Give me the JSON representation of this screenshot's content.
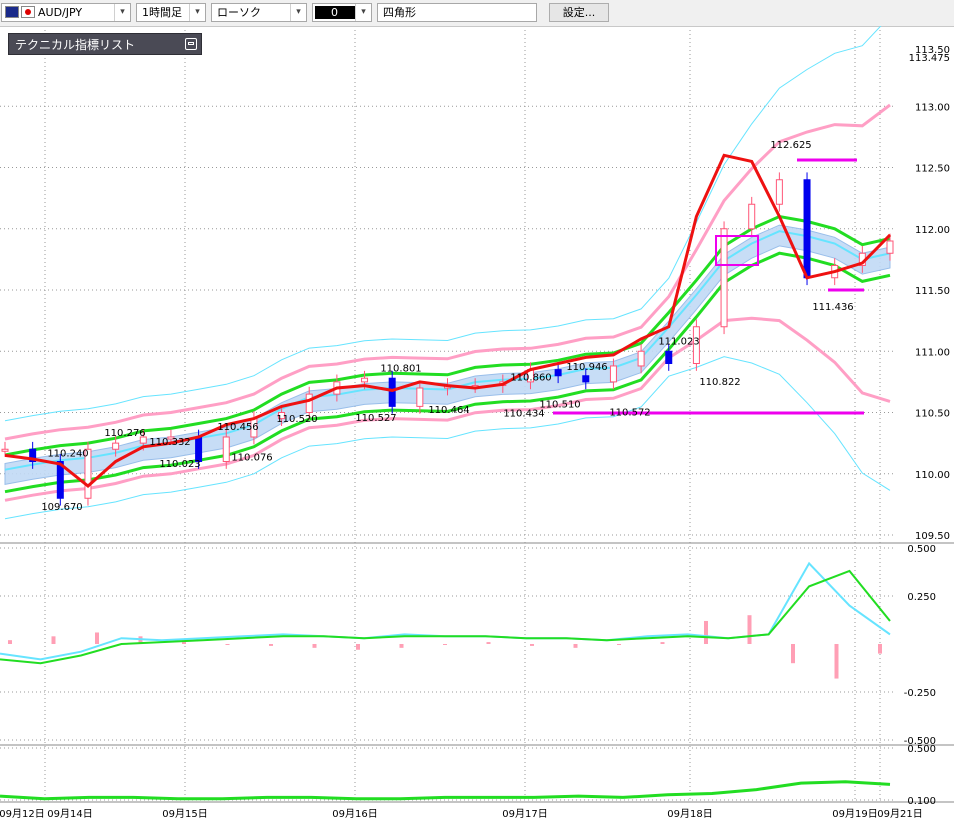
{
  "toolbar": {
    "symbol": "AUD/JPY",
    "timeframe": "1時間足",
    "chart_style": "ローソク",
    "color_swatch": "0",
    "shape": "四角形",
    "settings_label": "設定..."
  },
  "indicator_panel": {
    "title": "テクニカル指標リスト"
  },
  "colors": {
    "ma_red": "#ee1111",
    "bollinger_pink": "#ff9fc5",
    "bollinger_cyan": "#66e4ff",
    "envelope_green": "#22dd22",
    "marker_magenta": "#ee00ee",
    "up_candle": "#ff5577",
    "down_candle": "#0000ee",
    "cloud": "#c2daf6"
  },
  "chart_data": [
    {
      "type": "candlestick",
      "title": "",
      "y_axis_labels": [
        "113.00",
        "112.50",
        "112.00",
        "111.50",
        "111.00",
        "110.50",
        "110.00",
        "109.50"
      ],
      "y_axis_top_labels": [
        "113.50",
        "113.475"
      ],
      "ylim": [
        109.5,
        113.5
      ],
      "x_axis_labels": [
        "09月12日",
        "09月14日",
        "09月15日",
        "09月16日",
        "09月17日",
        "09月18日",
        "09月19日",
        "09月21日"
      ],
      "price_annotations": [
        {
          "label": "109.670",
          "value": 109.67
        },
        {
          "label": "110.240",
          "value": 110.24
        },
        {
          "label": "110.276",
          "value": 110.276
        },
        {
          "label": "110.332",
          "value": 110.332
        },
        {
          "label": "110.023",
          "value": 110.023
        },
        {
          "label": "110.456",
          "value": 110.456
        },
        {
          "label": "110.076",
          "value": 110.076
        },
        {
          "label": "110.520",
          "value": 110.52
        },
        {
          "label": "110.801",
          "value": 110.801
        },
        {
          "label": "110.527",
          "value": 110.527
        },
        {
          "label": "110.464",
          "value": 110.464
        },
        {
          "label": "110.860",
          "value": 110.86
        },
        {
          "label": "110.434",
          "value": 110.434
        },
        {
          "label": "110.946",
          "value": 110.946
        },
        {
          "label": "110.510",
          "value": 110.51
        },
        {
          "label": "110.572",
          "value": 110.572
        },
        {
          "label": "111.023",
          "value": 111.023
        },
        {
          "label": "110.822",
          "value": 110.822
        },
        {
          "label": "112.625",
          "value": 112.625
        },
        {
          "label": "111.436",
          "value": 111.436
        }
      ],
      "ma_line": [
        110.15,
        110.12,
        110.08,
        109.9,
        110.1,
        110.22,
        110.25,
        110.3,
        110.4,
        110.45,
        110.55,
        110.6,
        110.7,
        110.72,
        110.68,
        110.75,
        110.72,
        110.7,
        110.73,
        110.85,
        110.9,
        110.95,
        110.97,
        111.1,
        111.2,
        112.1,
        112.6,
        112.55,
        112.1,
        111.6,
        111.65,
        111.72,
        111.95
      ],
      "candle_close_samples": [
        110.2,
        110.1,
        109.8,
        110.2,
        110.25,
        110.3,
        110.3,
        110.1,
        110.3,
        110.45,
        110.5,
        110.65,
        110.75,
        110.78,
        110.55,
        110.7,
        110.72,
        110.72,
        110.75,
        110.85,
        110.8,
        110.75,
        110.88,
        111.0,
        110.9,
        111.2,
        112.0,
        112.2,
        112.4,
        111.6,
        111.7,
        111.8,
        111.9
      ]
    },
    {
      "type": "line",
      "title": "",
      "y_axis_labels": [
        "0.500",
        "0.250",
        "-0.250",
        "-0.500"
      ],
      "ylim": [
        -0.5,
        0.5
      ],
      "series": [
        {
          "values": [
            -0.05,
            -0.08,
            -0.04,
            0.03,
            0.02,
            0.03,
            0.04,
            0.05,
            0.04,
            0.03,
            0.05,
            0.04,
            0.04,
            0.03,
            0.03,
            0.02,
            0.04,
            0.05,
            0.03,
            0.05,
            0.42,
            0.2,
            0.05
          ]
        },
        {
          "values": [
            -0.08,
            -0.1,
            -0.06,
            0.0,
            0.01,
            0.02,
            0.03,
            0.04,
            0.04,
            0.03,
            0.04,
            0.04,
            0.04,
            0.03,
            0.03,
            0.02,
            0.03,
            0.04,
            0.03,
            0.05,
            0.3,
            0.38,
            0.12
          ]
        }
      ],
      "histogram": [
        0.02,
        0.04,
        0.06,
        0.04,
        0.02,
        0.0,
        -0.01,
        -0.02,
        -0.03,
        -0.02,
        0.0,
        0.01,
        -0.01,
        -0.02,
        0.0,
        0.01,
        0.12,
        0.15,
        -0.1,
        -0.18,
        -0.05
      ]
    },
    {
      "type": "line",
      "title": "",
      "y_axis_labels": [
        "0.500",
        "0.100"
      ],
      "ylim": [
        0.1,
        0.5
      ],
      "series": [
        {
          "values": [
            0.13,
            0.11,
            0.12,
            0.12,
            0.11,
            0.11,
            0.12,
            0.12,
            0.11,
            0.11,
            0.12,
            0.12,
            0.12,
            0.13,
            0.12,
            0.14,
            0.15,
            0.18,
            0.23,
            0.24,
            0.22
          ]
        }
      ]
    }
  ]
}
